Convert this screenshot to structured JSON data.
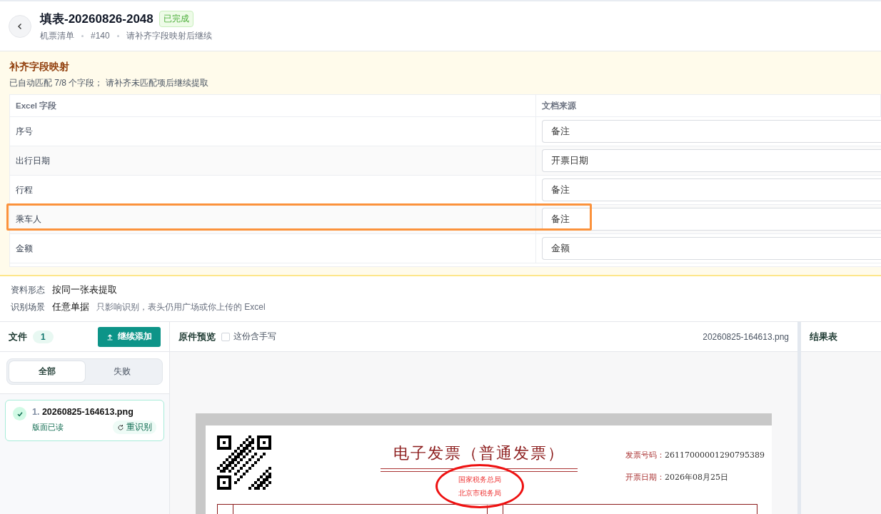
{
  "header": {
    "title": "填表-20260826-2048",
    "status": "已完成",
    "meta": [
      "机票清单",
      "#140",
      "请补齐字段映射后继续"
    ]
  },
  "mapping": {
    "title": "补齐字段映射",
    "subtitle": "已自动匹配 7/8 个字段； 请补齐未匹配项后继续提取",
    "columns": [
      "Excel 字段",
      "文档来源"
    ],
    "rows": [
      {
        "field": "序号",
        "source": "备注",
        "highlighted": false
      },
      {
        "field": "出行日期",
        "source": "开票日期",
        "highlighted": false
      },
      {
        "field": "行程",
        "source": "备注",
        "highlighted": false
      },
      {
        "field": "乘车人",
        "source": "备注",
        "highlighted": true
      },
      {
        "field": "金额",
        "source": "金额",
        "highlighted": false
      }
    ]
  },
  "settings": [
    {
      "label": "资料形态",
      "value": "按同一张表提取"
    },
    {
      "label": "识别场景",
      "value": "任意单据",
      "hint": "只影响识别，表头仍用广场或你上传的 Excel"
    }
  ],
  "files": {
    "title": "文件",
    "count": "1",
    "add_button": "继续添加",
    "filters": [
      {
        "label": "全部",
        "selected": true
      },
      {
        "label": "失败",
        "selected": false
      }
    ],
    "items": [
      {
        "index": "1.",
        "name": "20260825-164613.png",
        "status": "版面已读",
        "action": "重识别",
        "done": true
      }
    ]
  },
  "preview": {
    "title": "原件预览",
    "handwriting": {
      "label": "这份含手写",
      "checked": false
    },
    "filename": "20260825-164613.png",
    "document": {
      "title": "电子发票（普通发票）",
      "fields": [
        {
          "label": "发票号码：",
          "value": "26117000001290795389"
        },
        {
          "label": "开票日期：",
          "value": "2026年08月25日"
        }
      ],
      "stamp": [
        "国家税务总局",
        "北京市税务局"
      ]
    }
  },
  "result": {
    "title": "结果表"
  }
}
